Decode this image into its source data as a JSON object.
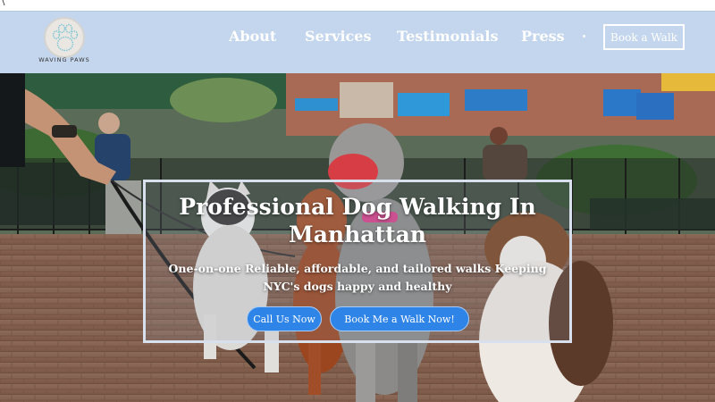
{
  "top_strip": {
    "mark": "\\"
  },
  "header": {
    "brand": "WAVING PAWS",
    "logo_icon": "paw-print-icon",
    "nav": [
      {
        "label": "About"
      },
      {
        "label": "Services"
      },
      {
        "label": "Testimonials"
      },
      {
        "label": "Press"
      }
    ],
    "cta_label": "Book a Walk"
  },
  "hero": {
    "title": "Professional Dog Walking In Manhattan",
    "subtitle": "One-on-one Reliable, affordable, and tailored walks Keeping NYC's dogs happy and healthy",
    "primary_button": "Call Us Now",
    "secondary_button": "Book Me a Walk Now!"
  },
  "colors": {
    "header_bg": "#c4d6ee",
    "button_blue": "#2f84e8",
    "paw_teal": "#7fc6d4"
  }
}
